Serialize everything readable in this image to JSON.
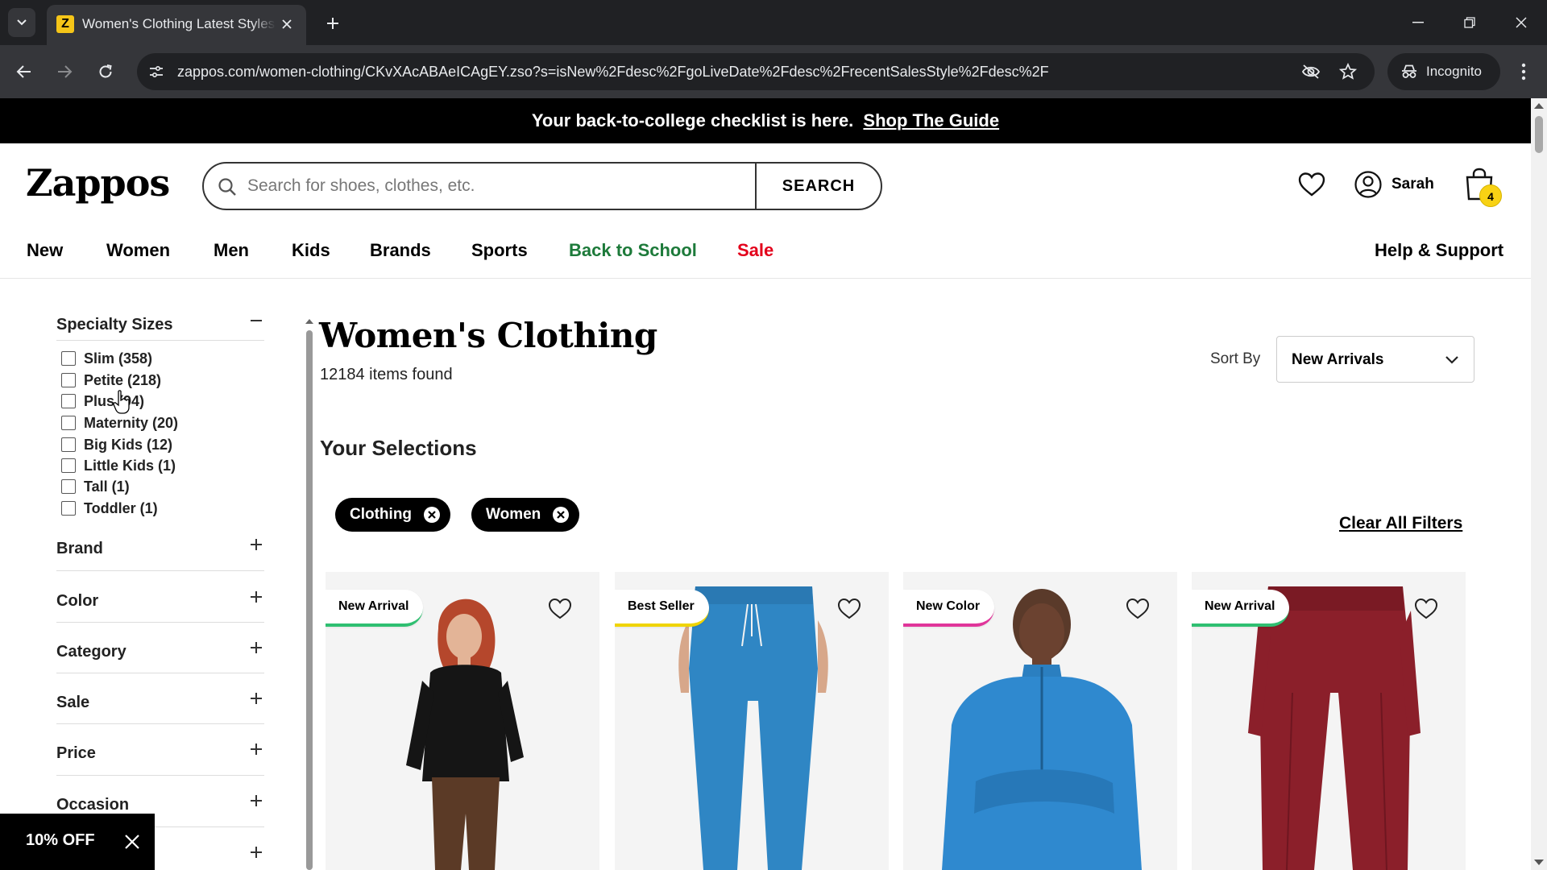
{
  "browser": {
    "tab_title": "Women's Clothing Latest Styles",
    "favicon_letter": "Z",
    "url": "zappos.com/women-clothing/CKvXAcABAeICAgEY.zso?s=isNew%2Fdesc%2FgoLiveDate%2Fdesc%2FrecentSalesStyle%2Fdesc%2F",
    "incognito_label": "Incognito"
  },
  "promo": {
    "text": "Your back-to-college checklist is here.",
    "link": "Shop The Guide"
  },
  "header": {
    "logo": "Zappos",
    "search_placeholder": "Search for shoes, clothes, etc.",
    "search_button": "SEARCH",
    "user_name": "Sarah",
    "cart_count": "4"
  },
  "nav": {
    "items": [
      "New",
      "Women",
      "Men",
      "Kids",
      "Brands",
      "Sports",
      "Back to School",
      "Sale"
    ],
    "help": "Help & Support"
  },
  "sidebar": {
    "specialty_title": "Specialty Sizes",
    "specialty_options": [
      "Slim (358)",
      "Petite (218)",
      "Plus (94)",
      "Maternity (20)",
      "Big Kids (12)",
      "Little Kids (1)",
      "Tall (1)",
      "Toddler (1)"
    ],
    "facets": [
      "Brand",
      "Color",
      "Category",
      "Sale",
      "Price",
      "Occasion"
    ],
    "toast": "10% OFF"
  },
  "main": {
    "title": "Women's Clothing",
    "items_found": "12184 items found",
    "sort_label": "Sort By",
    "sort_value": "New Arrivals",
    "selections_title": "Your Selections",
    "chips": [
      "Clothing",
      "Women"
    ],
    "clear_all": "Clear All Filters"
  },
  "products": [
    {
      "badge": "New Arrival",
      "badge_color": "#2fbf71"
    },
    {
      "badge": "Best Seller",
      "badge_color": "#f0d400"
    },
    {
      "badge": "New Color",
      "badge_color": "#e0359a"
    },
    {
      "badge": "New Arrival",
      "badge_color": "#2fbf71"
    }
  ],
  "colors": {
    "back_to_school": "#1d7a3a",
    "sale": "#e3001b",
    "cart_badge": "#f8d214"
  }
}
